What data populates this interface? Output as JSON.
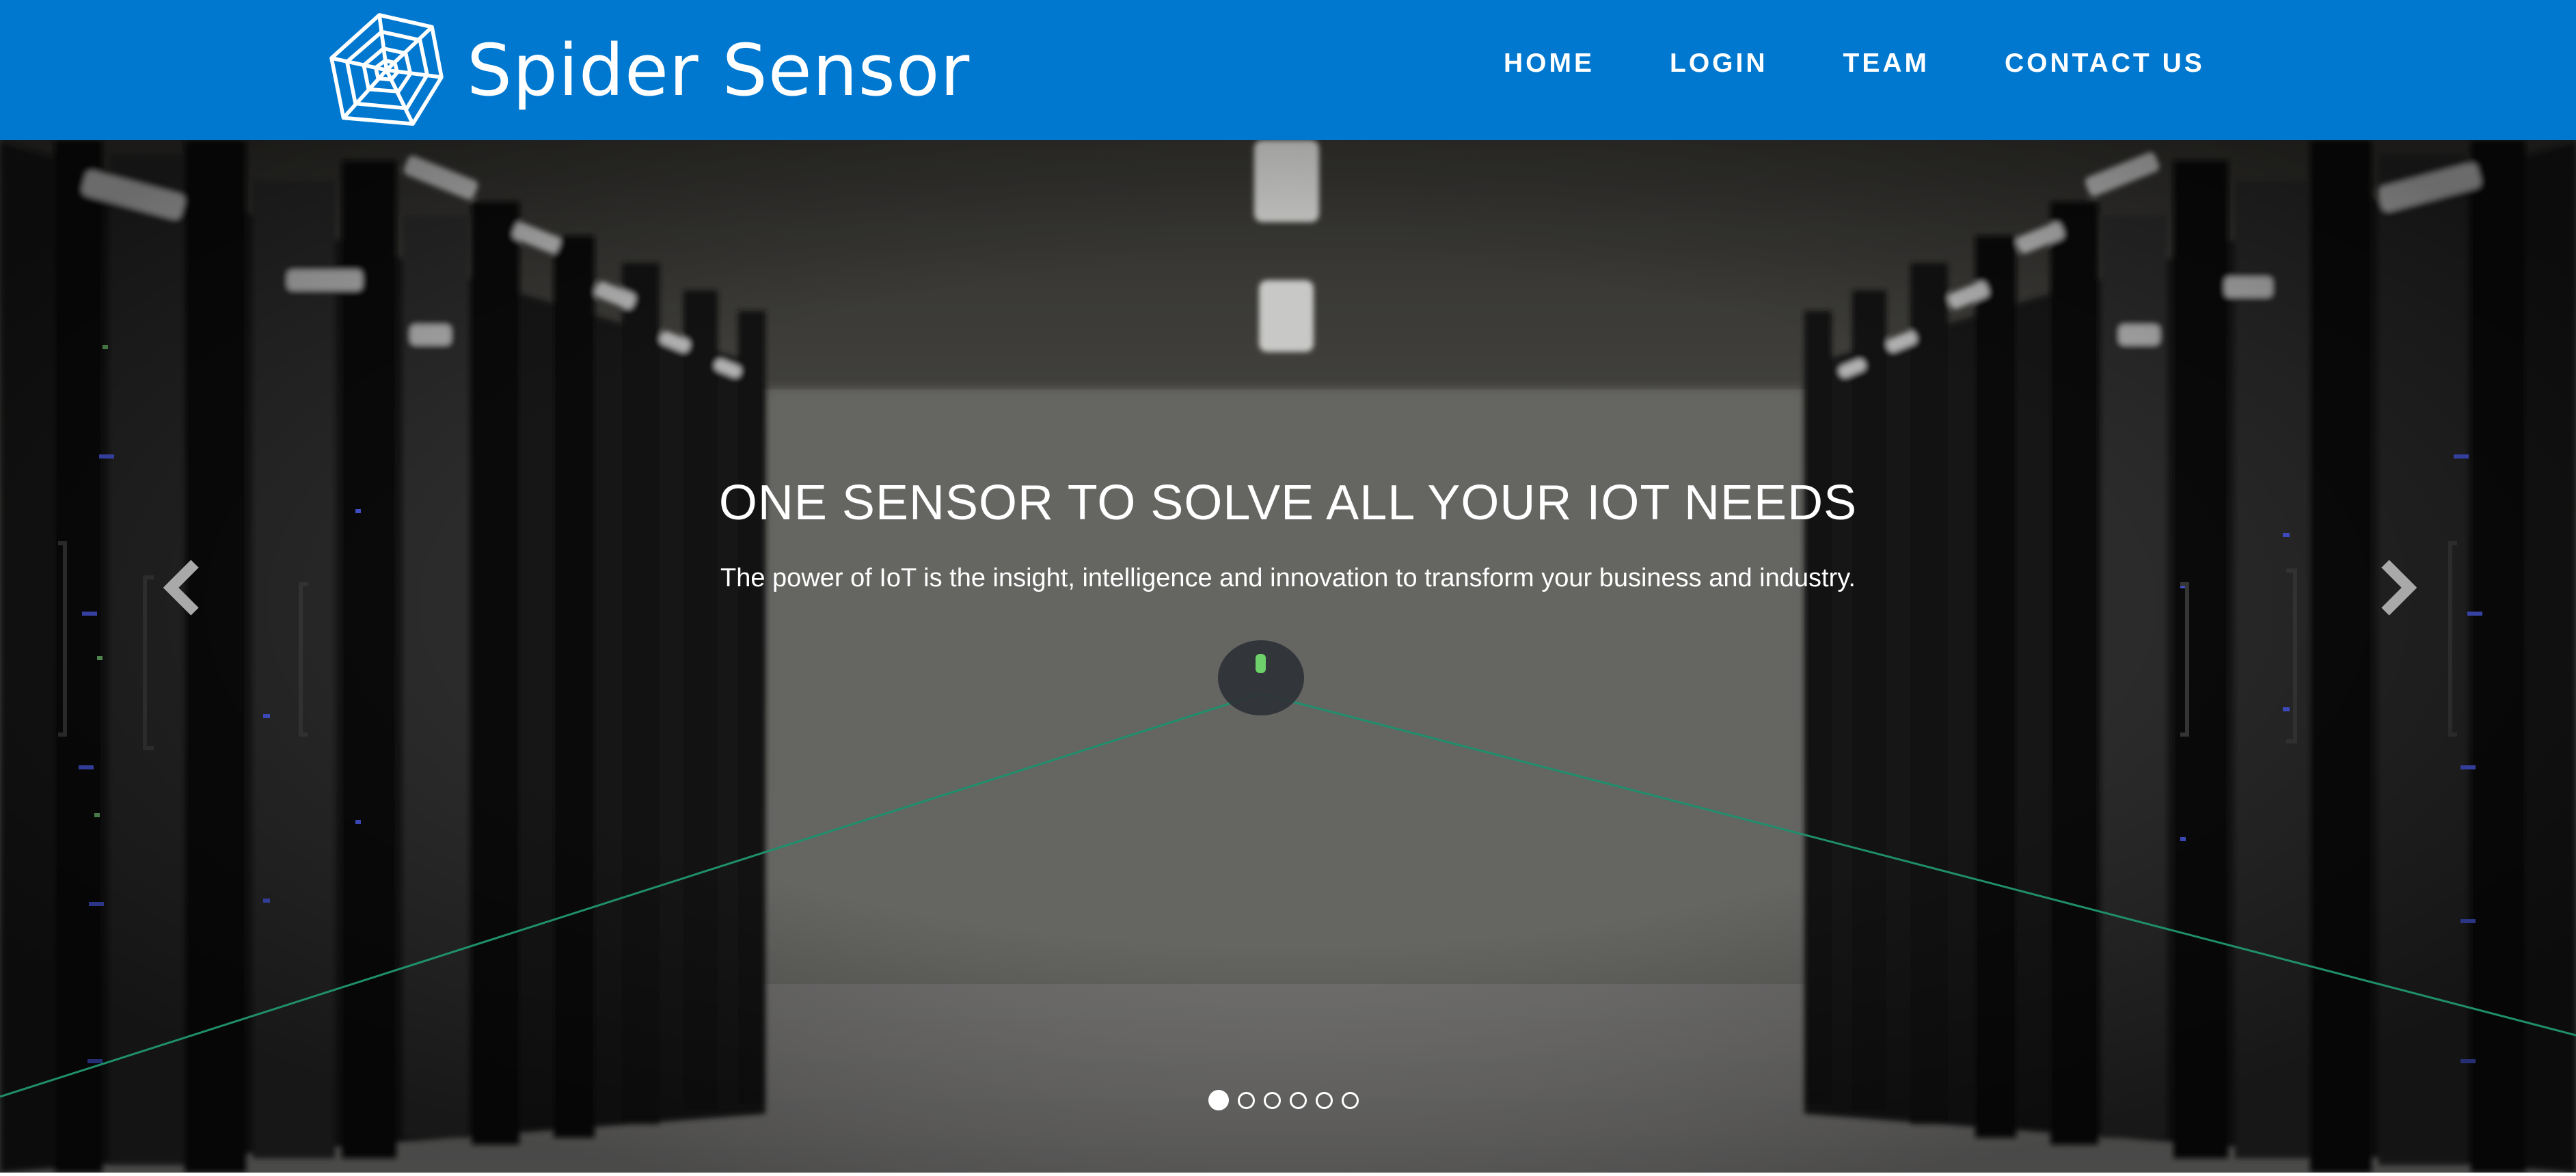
{
  "brand": {
    "name": "Spider Sensor",
    "logo_icon": "spider-web-icon"
  },
  "nav": {
    "items": [
      {
        "label": "HOME"
      },
      {
        "label": "LOGIN"
      },
      {
        "label": "TEAM"
      },
      {
        "label": "CONTACT US"
      }
    ]
  },
  "hero": {
    "title": "ONE SENSOR TO SOLVE ALL YOUR IOT NEEDS",
    "subtitle": "The power of IoT is the insight, intelligence and innovation to transform your business and industry.",
    "prev_icon": "chevron-left-icon",
    "next_icon": "chevron-right-icon",
    "slides_total": 6,
    "active_slide": 1
  },
  "colors": {
    "navbar": "#0078cf",
    "text": "#ffffff",
    "sensor_line": "#1f8f6c"
  }
}
